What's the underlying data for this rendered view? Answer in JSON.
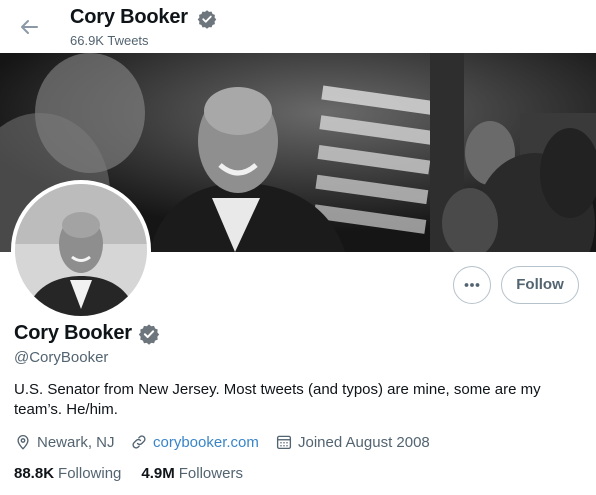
{
  "header": {
    "name": "Cory Booker",
    "tweet_count": "66.9K Tweets"
  },
  "icons": {
    "back": "arrow-left-icon",
    "verified": "verified-badge-icon",
    "more": "more-horizontal-icon",
    "location": "location-pin-icon",
    "link": "link-icon",
    "calendar": "calendar-icon"
  },
  "profile": {
    "name": "Cory Booker",
    "handle": "@CoryBooker",
    "bio": "U.S. Senator from New Jersey. Most tweets (and typos) are mine, some are my team’s. He/him.",
    "location": "Newark, NJ",
    "website": "corybooker.com",
    "joined": "Joined August 2008"
  },
  "actions": {
    "follow_label": "Follow"
  },
  "stats": {
    "following_count": "88.8K",
    "following_label": "Following",
    "followers_count": "4.9M",
    "followers_label": "Followers"
  },
  "colors": {
    "link": "#3a85c8",
    "muted": "#536471",
    "verified_badge": "#6e767d"
  }
}
